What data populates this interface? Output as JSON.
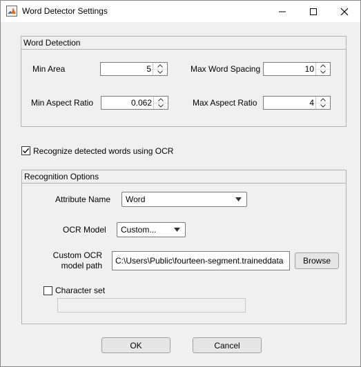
{
  "window": {
    "title": "Word Detector Settings",
    "controls": {
      "minimize_icon": "minimize-icon",
      "maximize_icon": "maximize-icon",
      "close_icon": "close-icon"
    }
  },
  "word_detection": {
    "title": "Word Detection",
    "min_area": {
      "label": "Min Area",
      "value": "5"
    },
    "max_word_spacing": {
      "label": "Max Word Spacing",
      "value": "10"
    },
    "min_aspect_ratio": {
      "label": "Min Aspect Ratio",
      "value": "0.062"
    },
    "max_aspect_ratio": {
      "label": "Max Aspect Ratio",
      "value": "4"
    }
  },
  "ocr_checkbox": {
    "label": "Recognize detected words using OCR",
    "checked": true
  },
  "recognition_options": {
    "title": "Recognition Options",
    "attribute_name": {
      "label": "Attribute Name",
      "value": "Word"
    },
    "ocr_model": {
      "label": "OCR Model",
      "value": "Custom..."
    },
    "custom_model_path": {
      "label_line1": "Custom OCR",
      "label_line2": "model path",
      "value": "C:\\Users\\Public\\fourteen-segment.traineddata",
      "browse_label": "Browse"
    },
    "character_set": {
      "label": "Character set",
      "checked": false,
      "value": ""
    }
  },
  "footer": {
    "ok_label": "OK",
    "cancel_label": "Cancel"
  },
  "colors": {
    "accent": "#0078d7",
    "background": "#f0f0f0"
  }
}
